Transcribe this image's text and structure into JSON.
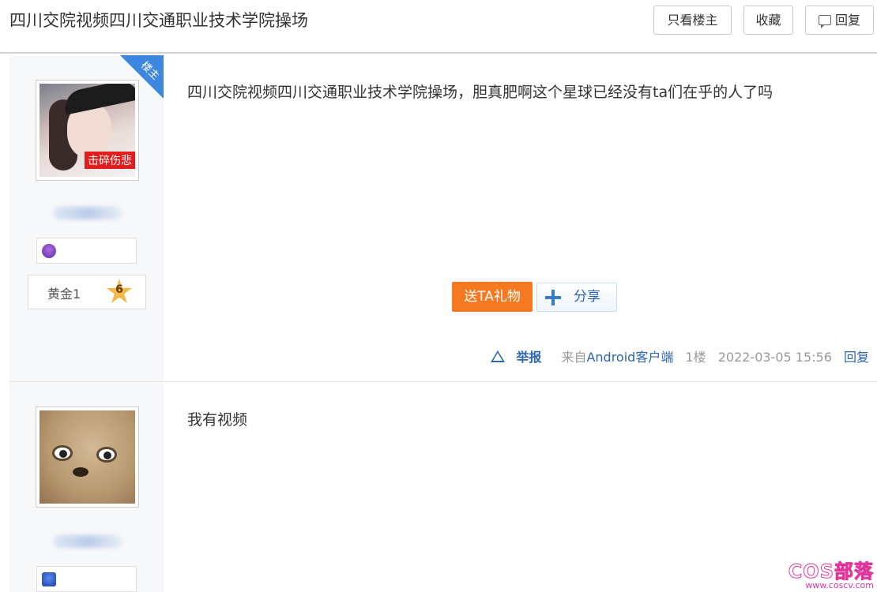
{
  "header": {
    "title": "四川交院视频四川交通职业技术学院操场",
    "only_owner_label": "只看楼主",
    "favorite_label": "收藏",
    "reply_label": "回复"
  },
  "posts": [
    {
      "badge": "楼主",
      "avatar_tag": "击碎伤悲",
      "rank_label": "黄金1",
      "rank_level": "6",
      "text": "四川交院视频四川交通职业技术学院操场，胆真肥啊这个星球已经没有ta们在乎的人了吗",
      "gift_label": "送TA礼物",
      "share_label": "分享",
      "report_label": "举报",
      "from_prefix": "来自",
      "from_client": "Android客户端",
      "floor": "1楼",
      "time": "2022-03-05 15:56",
      "reply_label": "回复"
    },
    {
      "text": "我有视频"
    }
  ],
  "watermark": {
    "brand": "COS部落",
    "site": "www.coscv.com"
  }
}
